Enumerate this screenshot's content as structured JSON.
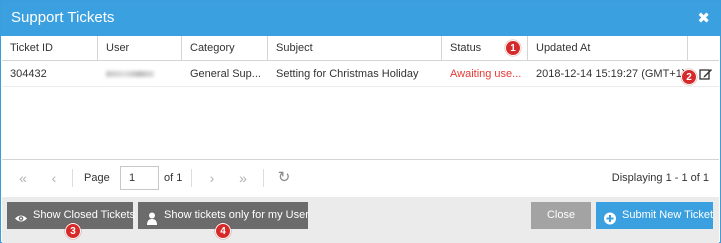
{
  "dialog": {
    "title": "Support Tickets",
    "close_glyph": "✖"
  },
  "table": {
    "headers": [
      "Ticket ID",
      "User",
      "Category",
      "Subject",
      "Status",
      "Updated At"
    ],
    "rows": [
      {
        "ticket_id": "304432",
        "user": "",
        "category": "General Sup...",
        "subject": "Setting for Christmas Holiday",
        "status": "Awaiting use...",
        "updated_at": "2018-12-14 15:19:27 (GMT+1)"
      }
    ]
  },
  "pager": {
    "first_glyph": "«",
    "prev_glyph": "‹",
    "next_glyph": "›",
    "last_glyph": "»",
    "refresh_glyph": "↻",
    "page_label": "Page",
    "page_value": "1",
    "of_label": "of 1",
    "display_text": "Displaying 1 - 1 of 1"
  },
  "footer": {
    "show_closed_label": "Show Closed Tickets",
    "show_my_user_label": "Show tickets only for my User",
    "close_label": "Close",
    "submit_label": "Submit New Ticket"
  },
  "annotations": [
    "1",
    "2",
    "3",
    "4"
  ],
  "colors": {
    "accent": "#3ba0e0",
    "status_red": "#e53935",
    "badge_red": "#d62a2a",
    "button_dark": "#6b6b6b",
    "button_grey": "#a3a3a3"
  },
  "icons": {
    "close": "close-icon",
    "edit": "edit-icon",
    "refresh": "refresh-icon",
    "eye": "eye-icon",
    "user": "user-icon",
    "plus": "plus-circle-icon"
  }
}
